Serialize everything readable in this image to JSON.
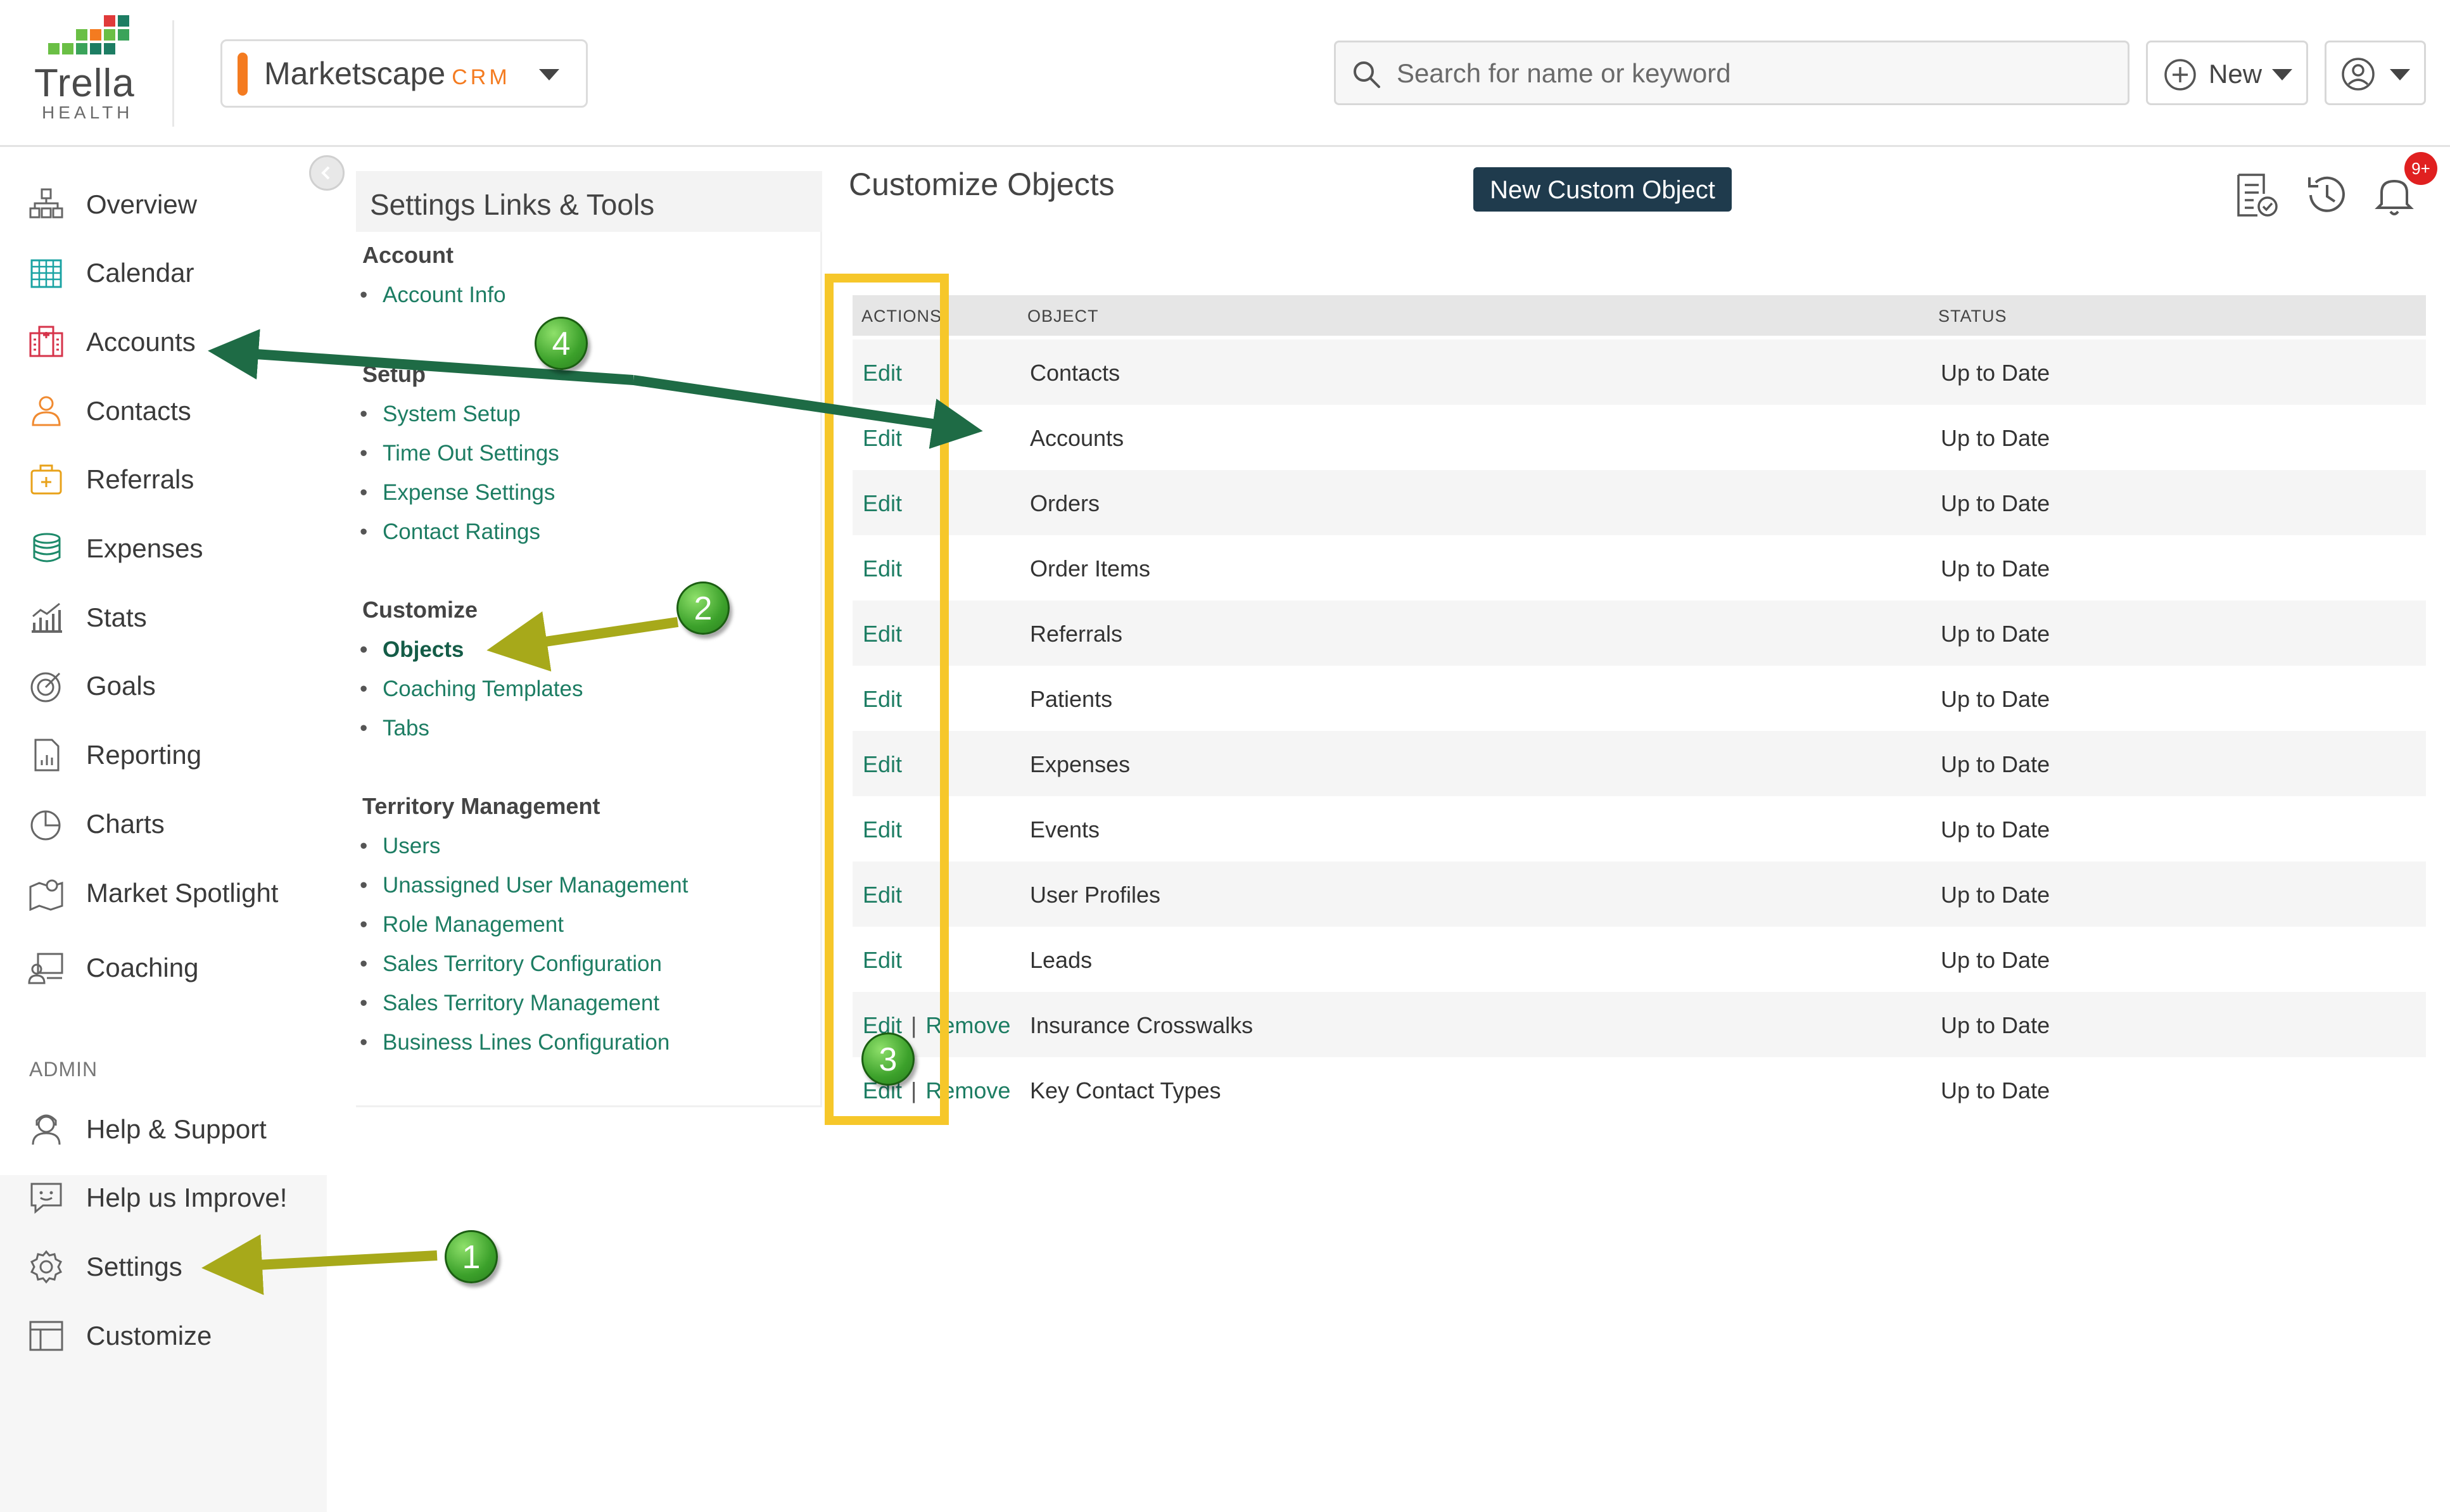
{
  "brand": {
    "name": "Trella",
    "sub": "HEALTH",
    "colors": [
      "#f47b20",
      "#6abf45",
      "#1d7d63",
      "#3aa35a"
    ]
  },
  "app_switcher": {
    "name": "Marketscape",
    "suffix": "CRM",
    "accent": "#f47b20"
  },
  "search": {
    "placeholder": "Search for name or keyword"
  },
  "header": {
    "new_label": "New"
  },
  "sidebar": {
    "items": [
      {
        "label": "Overview",
        "icon": "overview-icon"
      },
      {
        "label": "Calendar",
        "icon": "calendar-icon"
      },
      {
        "label": "Accounts",
        "icon": "accounts-icon"
      },
      {
        "label": "Contacts",
        "icon": "contacts-icon"
      },
      {
        "label": "Referrals",
        "icon": "referrals-icon"
      },
      {
        "label": "Expenses",
        "icon": "expenses-icon"
      },
      {
        "label": "Stats",
        "icon": "stats-icon"
      },
      {
        "label": "Goals",
        "icon": "goals-icon"
      },
      {
        "label": "Reporting",
        "icon": "reporting-icon"
      },
      {
        "label": "Charts",
        "icon": "charts-icon"
      },
      {
        "label": "Market Spotlight",
        "icon": "map-icon"
      },
      {
        "label": "Coaching",
        "icon": "coaching-icon"
      }
    ],
    "admin_heading": "ADMIN",
    "admin_items": [
      {
        "label": "Help & Support",
        "icon": "support-icon"
      },
      {
        "label": "Help us Improve!",
        "icon": "feedback-icon"
      },
      {
        "label": "Settings",
        "icon": "gear-icon"
      },
      {
        "label": "Customize",
        "icon": "layout-icon"
      }
    ]
  },
  "settings_panel": {
    "title": "Settings Links & Tools",
    "groups": [
      {
        "name": "Account",
        "links": [
          "Account Info"
        ]
      },
      {
        "name": "Setup",
        "links": [
          "System Setup",
          "Time Out Settings",
          "Expense Settings",
          "Contact Ratings"
        ]
      },
      {
        "name": "Customize",
        "links": [
          "Objects",
          "Coaching Templates",
          "Tabs"
        ]
      },
      {
        "name": "Territory Management",
        "links": [
          "Users",
          "Unassigned User Management",
          "Role Management",
          "Sales Territory Configuration",
          "Sales Territory Management",
          "Business Lines Configuration"
        ]
      }
    ]
  },
  "main": {
    "title": "Customize Objects",
    "new_button": "New Custom Object",
    "notification_badge": "9+",
    "table": {
      "headers": [
        "ACTIONS",
        "OBJECT",
        "STATUS"
      ],
      "action_edit": "Edit",
      "action_remove": "Remove",
      "action_sep": "|",
      "rows": [
        {
          "object": "Contacts",
          "status": "Up to Date",
          "removable": false
        },
        {
          "object": "Accounts",
          "status": "Up to Date",
          "removable": false
        },
        {
          "object": "Orders",
          "status": "Up to Date",
          "removable": false
        },
        {
          "object": "Order Items",
          "status": "Up to Date",
          "removable": false
        },
        {
          "object": "Referrals",
          "status": "Up to Date",
          "removable": false
        },
        {
          "object": "Patients",
          "status": "Up to Date",
          "removable": false
        },
        {
          "object": "Expenses",
          "status": "Up to Date",
          "removable": false
        },
        {
          "object": "Events",
          "status": "Up to Date",
          "removable": false
        },
        {
          "object": "User Profiles",
          "status": "Up to Date",
          "removable": false
        },
        {
          "object": "Leads",
          "status": "Up to Date",
          "removable": false
        },
        {
          "object": "Insurance Crosswalks",
          "status": "Up to Date",
          "removable": true
        },
        {
          "object": "Key Contact Types",
          "status": "Up to Date",
          "removable": true
        }
      ]
    }
  },
  "annotations": {
    "markers": [
      "1",
      "2",
      "3",
      "4"
    ],
    "colors": {
      "yellow_box": "#f6c72a",
      "olive_arrow": "#a7a91a",
      "green_arrow": "#1e6b45",
      "marker": "#3ca12b"
    }
  }
}
